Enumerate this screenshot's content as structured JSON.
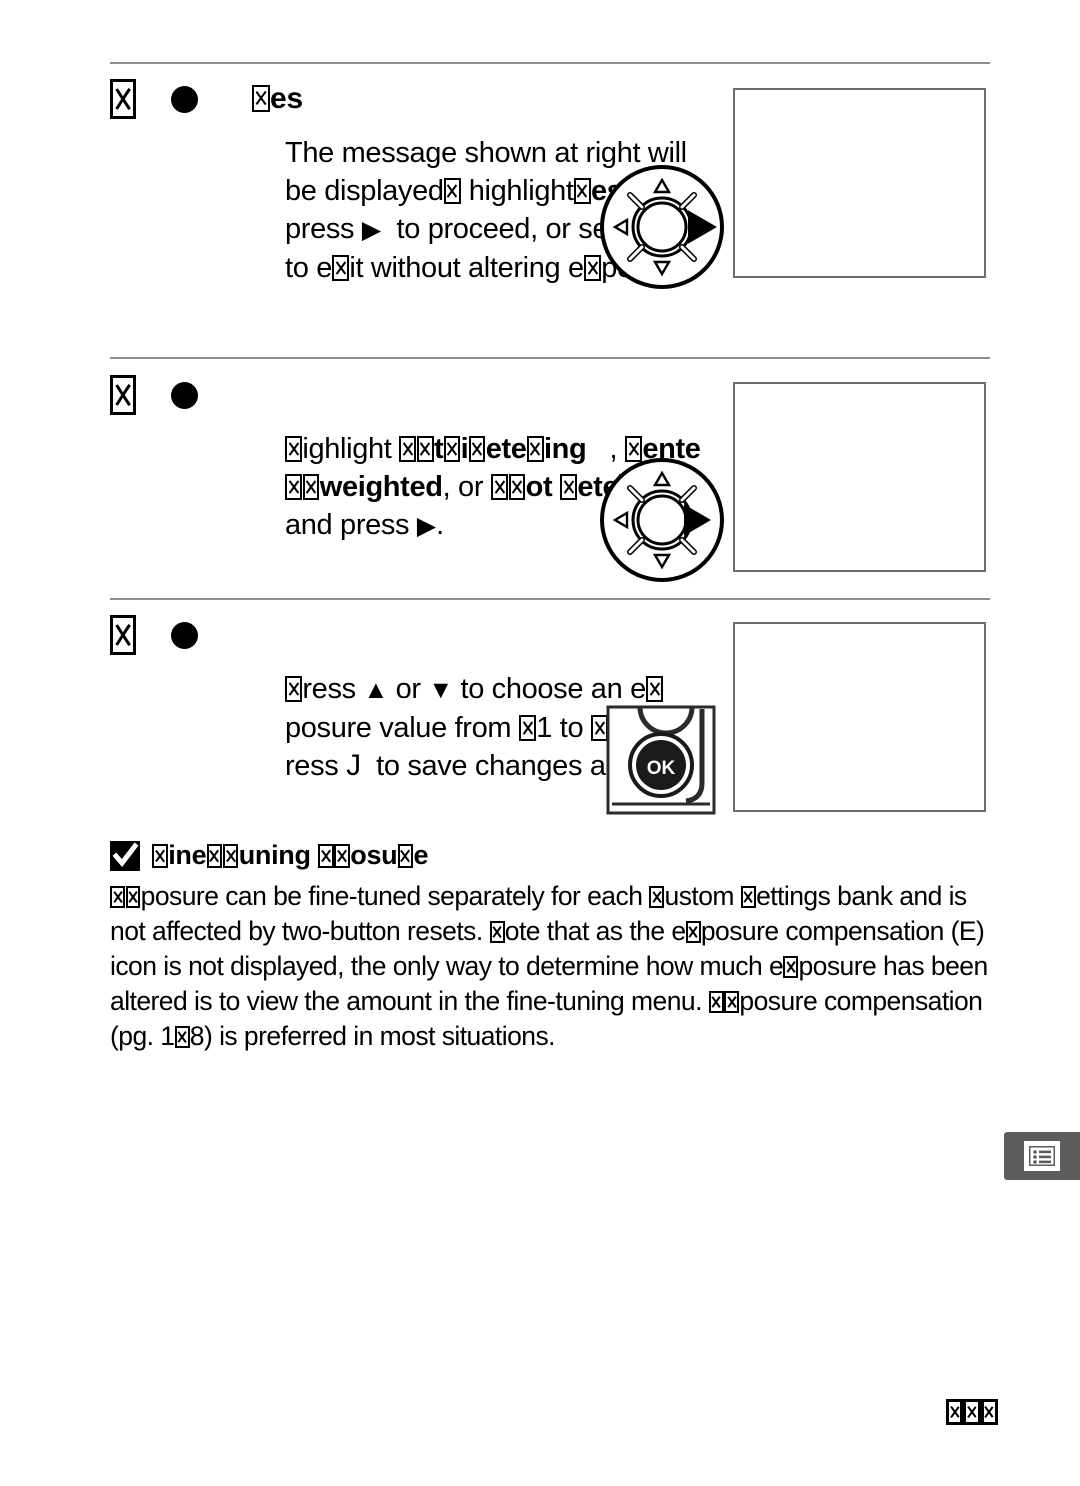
{
  "document": {
    "type": "camera-manual-page",
    "note": "Glyphs missing from the embedded font render as tofu boxes (box-with-X)."
  },
  "steps": [
    {
      "number_glyph": "tofu",
      "bullet": "filled-circle",
      "title_prefix_glyph": "tofu",
      "title": "es",
      "title_full_readable": "Yes",
      "body_lines": [
        "The message shown at right",
        "will be displayed⊠ highlight⊠es",
        "and press ▶ to proceed, or",
        "select ⊠o to e⊠it without",
        "altering e⊠posure."
      ],
      "body_readable": "The message shown at right will be displayed; highlight Yes and press ▶ to proceed, or select No to exit without altering exposure.",
      "illustration": "multi-selector-dial-right",
      "screen": "blank-screen-placeholder"
    },
    {
      "number_glyph": "tofu",
      "bullet": "filled-circle",
      "title": "",
      "body_readable": "Highlight Matrix metering, Center-weighted, or Spot metering and press ▶.",
      "illustration": "multi-selector-dial-right",
      "screen": "blank-screen-placeholder"
    },
    {
      "number_glyph": "tofu",
      "bullet": "filled-circle",
      "title": "",
      "body_readable": "Press ▲ or ▼ to choose an exposure value from −1 to +1 EV. Press OK to save changes and exit.",
      "illustration": "ok-button",
      "screen": "blank-screen-placeholder"
    }
  ],
  "note_section": {
    "icon": "check-square-icon",
    "heading_parts": [
      "tofu",
      "ine",
      "tofu",
      "tofu",
      "uning ",
      "tofu",
      "tofu",
      "osu",
      "tofu",
      "e"
    ],
    "heading_readable": "Fine-Tuning Exposure",
    "body_readable": "Exposure can be fine-tuned separately for each Custom Settings bank and is not affected by two-button resets. Note that as the exposure compensation (E) icon is not displayed, the only way to determine how much exposure has been altered is to view the amount in the fine-tuning menu. Exposure compensation (pg. 128) is preferred in most situations."
  },
  "side_tab": {
    "icon": "menu-list-icon",
    "color": "#5d5d5d"
  },
  "page_number": {
    "glyphs": [
      "tofu",
      "tofu",
      "tofu"
    ],
    "value": ""
  },
  "colors": {
    "rule": "#8d8d8d",
    "screen_border": "#6e6e6e",
    "tab": "#5d5d5d",
    "ink": "#000000",
    "paper": "#ffffff"
  },
  "glyphs": {
    "bullet": "●",
    "arrow_right": "▶",
    "arrow_up": "▲",
    "arrow_down": "▼",
    "ok_key": "J"
  }
}
